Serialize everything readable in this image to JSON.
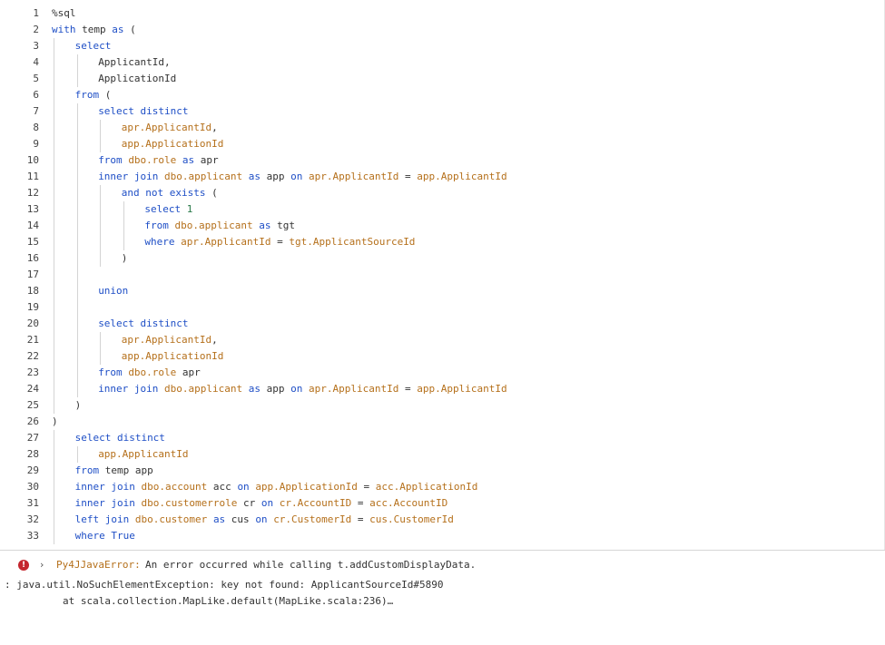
{
  "editor": {
    "lines": [
      {
        "n": "1",
        "indent": 0,
        "tokens": [
          [
            "t",
            "%sql"
          ]
        ]
      },
      {
        "n": "2",
        "indent": 0,
        "tokens": [
          [
            "k",
            "with"
          ],
          [
            "t",
            " temp "
          ],
          [
            "k",
            "as"
          ],
          [
            "t",
            " ("
          ]
        ]
      },
      {
        "n": "3",
        "indent": 1,
        "tokens": [
          [
            "k",
            "select"
          ]
        ]
      },
      {
        "n": "4",
        "indent": 2,
        "tokens": [
          [
            "t",
            "ApplicantId,"
          ]
        ]
      },
      {
        "n": "5",
        "indent": 2,
        "tokens": [
          [
            "t",
            "ApplicationId"
          ]
        ]
      },
      {
        "n": "6",
        "indent": 1,
        "tokens": [
          [
            "k",
            "from"
          ],
          [
            "t",
            " ("
          ]
        ]
      },
      {
        "n": "7",
        "indent": 2,
        "tokens": [
          [
            "k",
            "select distinct"
          ]
        ]
      },
      {
        "n": "8",
        "indent": 3,
        "tokens": [
          [
            "o",
            "apr.ApplicantId"
          ],
          [
            "t",
            ","
          ]
        ]
      },
      {
        "n": "9",
        "indent": 3,
        "tokens": [
          [
            "o",
            "app.ApplicationId"
          ]
        ]
      },
      {
        "n": "10",
        "indent": 2,
        "tokens": [
          [
            "k",
            "from"
          ],
          [
            "t",
            " "
          ],
          [
            "o",
            "dbo.role"
          ],
          [
            "t",
            " "
          ],
          [
            "k",
            "as"
          ],
          [
            "t",
            " apr"
          ]
        ]
      },
      {
        "n": "11",
        "indent": 2,
        "tokens": [
          [
            "k",
            "inner join"
          ],
          [
            "t",
            " "
          ],
          [
            "o",
            "dbo.applicant"
          ],
          [
            "t",
            " "
          ],
          [
            "k",
            "as"
          ],
          [
            "t",
            " app "
          ],
          [
            "k",
            "on"
          ],
          [
            "t",
            " "
          ],
          [
            "o",
            "apr.ApplicantId"
          ],
          [
            "t",
            " = "
          ],
          [
            "o",
            "app.ApplicantId"
          ]
        ]
      },
      {
        "n": "12",
        "indent": 3,
        "tokens": [
          [
            "k",
            "and not exists"
          ],
          [
            "t",
            " ("
          ]
        ]
      },
      {
        "n": "13",
        "indent": 4,
        "tokens": [
          [
            "k",
            "select"
          ],
          [
            "t",
            " "
          ],
          [
            "n",
            "1"
          ]
        ]
      },
      {
        "n": "14",
        "indent": 4,
        "tokens": [
          [
            "k",
            "from"
          ],
          [
            "t",
            " "
          ],
          [
            "o",
            "dbo.applicant"
          ],
          [
            "t",
            " "
          ],
          [
            "k",
            "as"
          ],
          [
            "t",
            " tgt"
          ]
        ]
      },
      {
        "n": "15",
        "indent": 4,
        "tokens": [
          [
            "k",
            "where"
          ],
          [
            "t",
            " "
          ],
          [
            "o",
            "apr.ApplicantId"
          ],
          [
            "t",
            " = "
          ],
          [
            "o",
            "tgt.ApplicantSourceId"
          ]
        ]
      },
      {
        "n": "16",
        "indent": 3,
        "tokens": [
          [
            "t",
            ")"
          ]
        ]
      },
      {
        "n": "17",
        "indent": 2,
        "tokens": []
      },
      {
        "n": "18",
        "indent": 2,
        "tokens": [
          [
            "k",
            "union"
          ]
        ]
      },
      {
        "n": "19",
        "indent": 2,
        "tokens": []
      },
      {
        "n": "20",
        "indent": 2,
        "tokens": [
          [
            "k",
            "select distinct"
          ]
        ]
      },
      {
        "n": "21",
        "indent": 3,
        "tokens": [
          [
            "o",
            "apr.ApplicantId"
          ],
          [
            "t",
            ","
          ]
        ]
      },
      {
        "n": "22",
        "indent": 3,
        "tokens": [
          [
            "o",
            "app.ApplicationId"
          ]
        ]
      },
      {
        "n": "23",
        "indent": 2,
        "tokens": [
          [
            "k",
            "from"
          ],
          [
            "t",
            " "
          ],
          [
            "o",
            "dbo.role"
          ],
          [
            "t",
            " apr"
          ]
        ]
      },
      {
        "n": "24",
        "indent": 2,
        "tokens": [
          [
            "k",
            "inner join"
          ],
          [
            "t",
            " "
          ],
          [
            "o",
            "dbo.applicant"
          ],
          [
            "t",
            " "
          ],
          [
            "k",
            "as"
          ],
          [
            "t",
            " app "
          ],
          [
            "k",
            "on"
          ],
          [
            "t",
            " "
          ],
          [
            "o",
            "apr.ApplicantId"
          ],
          [
            "t",
            " = "
          ],
          [
            "o",
            "app.ApplicantId"
          ]
        ]
      },
      {
        "n": "25",
        "indent": 1,
        "tokens": [
          [
            "t",
            ")"
          ]
        ]
      },
      {
        "n": "26",
        "indent": 0,
        "tokens": [
          [
            "t",
            ")"
          ]
        ]
      },
      {
        "n": "27",
        "indent": 1,
        "tokens": [
          [
            "k",
            "select distinct"
          ]
        ]
      },
      {
        "n": "28",
        "indent": 2,
        "tokens": [
          [
            "o",
            "app.ApplicantId"
          ]
        ]
      },
      {
        "n": "29",
        "indent": 1,
        "tokens": [
          [
            "k",
            "from"
          ],
          [
            "t",
            " temp app"
          ]
        ]
      },
      {
        "n": "30",
        "indent": 1,
        "tokens": [
          [
            "k",
            "inner join"
          ],
          [
            "t",
            " "
          ],
          [
            "o",
            "dbo.account"
          ],
          [
            "t",
            " acc "
          ],
          [
            "k",
            "on"
          ],
          [
            "t",
            " "
          ],
          [
            "o",
            "app.ApplicationId"
          ],
          [
            "t",
            " = "
          ],
          [
            "o",
            "acc.ApplicationId"
          ]
        ]
      },
      {
        "n": "31",
        "indent": 1,
        "tokens": [
          [
            "k",
            "inner join"
          ],
          [
            "t",
            " "
          ],
          [
            "o",
            "dbo.customerrole"
          ],
          [
            "t",
            " cr "
          ],
          [
            "k",
            "on"
          ],
          [
            "t",
            " "
          ],
          [
            "o",
            "cr.AccountID"
          ],
          [
            "t",
            " = "
          ],
          [
            "o",
            "acc.AccountID"
          ]
        ]
      },
      {
        "n": "32",
        "indent": 1,
        "tokens": [
          [
            "k",
            "left join"
          ],
          [
            "t",
            " "
          ],
          [
            "o",
            "dbo.customer"
          ],
          [
            "t",
            " "
          ],
          [
            "k",
            "as"
          ],
          [
            "t",
            " cus "
          ],
          [
            "k",
            "on"
          ],
          [
            "t",
            " "
          ],
          [
            "o",
            "cr.CustomerId"
          ],
          [
            "t",
            " = "
          ],
          [
            "o",
            "cus.CustomerId"
          ]
        ]
      },
      {
        "n": "33",
        "indent": 1,
        "tokens": [
          [
            "k",
            "where True"
          ]
        ]
      }
    ],
    "colors": {
      "keyword": "#1f4fc6",
      "identifier": "#b5701b",
      "number": "#2a7a4a",
      "text": "#333333"
    }
  },
  "output": {
    "error_icon": "error-circle-icon",
    "expand_icon": "chevron-right-icon",
    "chevron": "›",
    "error_type": "Py4JJavaError:",
    "error_message": "An error occurred while calling t.addCustomDisplayData.",
    "trace_line_1": ": java.util.NoSuchElementException: key not found: ApplicantSourceId#5890",
    "trace_line_2": "at scala.collection.MapLike.default(MapLike.scala:236)…"
  }
}
